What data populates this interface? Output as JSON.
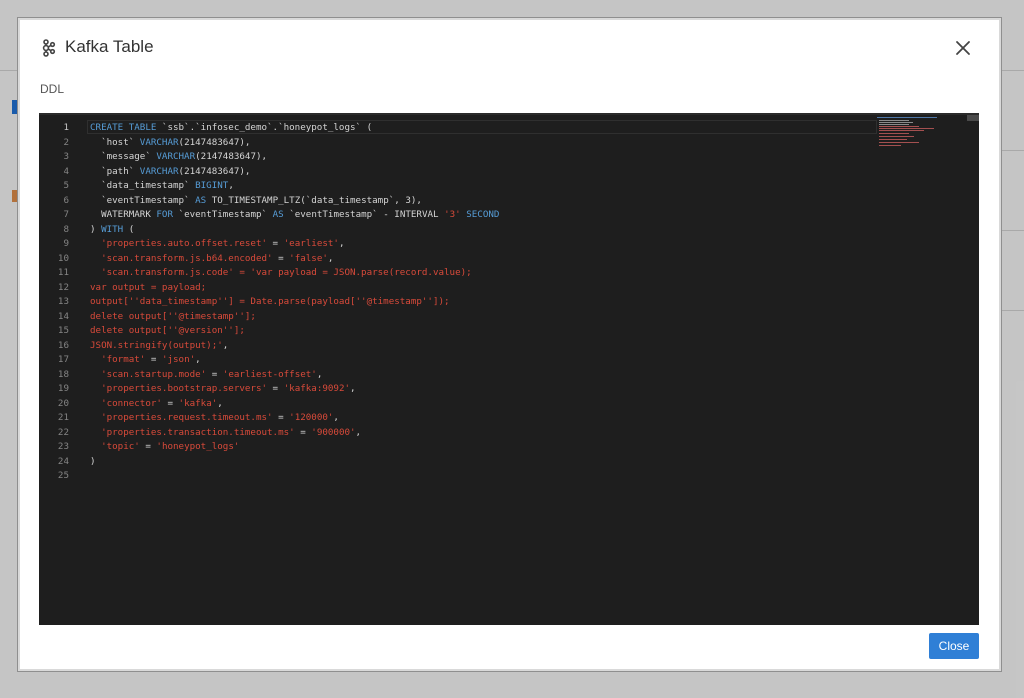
{
  "modal": {
    "title": "Kafka Table",
    "section_label": "DDL",
    "close_button_label": "Close",
    "close_icon": "close-icon",
    "title_icon": "kafka-icon"
  },
  "editor": {
    "active_line": 1,
    "lines": [
      [
        {
          "t": "CREATE TABLE ",
          "c": "kw"
        },
        {
          "t": "`ssb`.`infosec_demo`.`honeypot_logs` (",
          "c": "p"
        }
      ],
      [
        {
          "t": "  `host` ",
          "c": "p"
        },
        {
          "t": "VARCHAR",
          "c": "kw"
        },
        {
          "t": "(2147483647),",
          "c": "p"
        }
      ],
      [
        {
          "t": "  `message` ",
          "c": "p"
        },
        {
          "t": "VARCHAR",
          "c": "kw"
        },
        {
          "t": "(2147483647),",
          "c": "p"
        }
      ],
      [
        {
          "t": "  `path` ",
          "c": "p"
        },
        {
          "t": "VARCHAR",
          "c": "kw"
        },
        {
          "t": "(2147483647),",
          "c": "p"
        }
      ],
      [
        {
          "t": "  `data_timestamp` ",
          "c": "p"
        },
        {
          "t": "BIGINT",
          "c": "kw"
        },
        {
          "t": ",",
          "c": "p"
        }
      ],
      [
        {
          "t": "  `eventTimestamp` ",
          "c": "p"
        },
        {
          "t": "AS",
          "c": "kw"
        },
        {
          "t": " TO_TIMESTAMP_LTZ(`data_timestamp`, 3),",
          "c": "p"
        }
      ],
      [
        {
          "t": "  WATERMARK ",
          "c": "p"
        },
        {
          "t": "FOR",
          "c": "kw"
        },
        {
          "t": " `eventTimestamp` ",
          "c": "p"
        },
        {
          "t": "AS",
          "c": "kw"
        },
        {
          "t": " `eventTimestamp` - INTERVAL ",
          "c": "p"
        },
        {
          "t": "'3'",
          "c": "str"
        },
        {
          "t": " SECOND",
          "c": "kw"
        }
      ],
      [
        {
          "t": ") ",
          "c": "p"
        },
        {
          "t": "WITH",
          "c": "kw"
        },
        {
          "t": " (",
          "c": "p"
        }
      ],
      [
        {
          "t": "  'properties.auto.offset.reset'",
          "c": "str"
        },
        {
          "t": " = ",
          "c": "p"
        },
        {
          "t": "'earliest'",
          "c": "str"
        },
        {
          "t": ",",
          "c": "p"
        }
      ],
      [
        {
          "t": "  'scan.transform.js.b64.encoded'",
          "c": "str"
        },
        {
          "t": " = ",
          "c": "p"
        },
        {
          "t": "'false'",
          "c": "str"
        },
        {
          "t": ",",
          "c": "p"
        }
      ],
      [
        {
          "t": "  'scan.transform.js.code' = 'var payload = JSON.parse(record.value);",
          "c": "str"
        }
      ],
      [
        {
          "t": "var output = payload;",
          "c": "str"
        }
      ],
      [
        {
          "t": "output[''data_timestamp''] = Date.parse(payload[''@timestamp'']);",
          "c": "str"
        }
      ],
      [
        {
          "t": "delete output[''@timestamp''];",
          "c": "str"
        }
      ],
      [
        {
          "t": "delete output[''@version''];",
          "c": "str"
        }
      ],
      [
        {
          "t": "JSON.stringify(output);'",
          "c": "str"
        },
        {
          "t": ",",
          "c": "p"
        }
      ],
      [
        {
          "t": "  'format'",
          "c": "str"
        },
        {
          "t": " = ",
          "c": "p"
        },
        {
          "t": "'json'",
          "c": "str"
        },
        {
          "t": ",",
          "c": "p"
        }
      ],
      [
        {
          "t": "  'scan.startup.mode'",
          "c": "str"
        },
        {
          "t": " = ",
          "c": "p"
        },
        {
          "t": "'earliest-offset'",
          "c": "str"
        },
        {
          "t": ",",
          "c": "p"
        }
      ],
      [
        {
          "t": "  'properties.bootstrap.servers'",
          "c": "str"
        },
        {
          "t": " = ",
          "c": "p"
        },
        {
          "t": "'kafka:9092'",
          "c": "str"
        },
        {
          "t": ",",
          "c": "p"
        }
      ],
      [
        {
          "t": "  'connector'",
          "c": "str"
        },
        {
          "t": " = ",
          "c": "p"
        },
        {
          "t": "'kafka'",
          "c": "str"
        },
        {
          "t": ",",
          "c": "p"
        }
      ],
      [
        {
          "t": "  'properties.request.timeout.ms'",
          "c": "str"
        },
        {
          "t": " = ",
          "c": "p"
        },
        {
          "t": "'120000'",
          "c": "str"
        },
        {
          "t": ",",
          "c": "p"
        }
      ],
      [
        {
          "t": "  'properties.transaction.timeout.ms'",
          "c": "str"
        },
        {
          "t": " = ",
          "c": "p"
        },
        {
          "t": "'900000'",
          "c": "str"
        },
        {
          "t": ",",
          "c": "p"
        }
      ],
      [
        {
          "t": "  'topic'",
          "c": "str"
        },
        {
          "t": " = ",
          "c": "p"
        },
        {
          "t": "'honeypot_logs'",
          "c": "str"
        }
      ],
      [
        {
          "t": ")",
          "c": "p"
        }
      ],
      []
    ]
  },
  "colors": {
    "keyword": "#569cd6",
    "string": "#d84a3a",
    "plain": "#d4d4d4",
    "editor_bg": "#1e1e1e",
    "primary_button": "#2f7fd6"
  }
}
